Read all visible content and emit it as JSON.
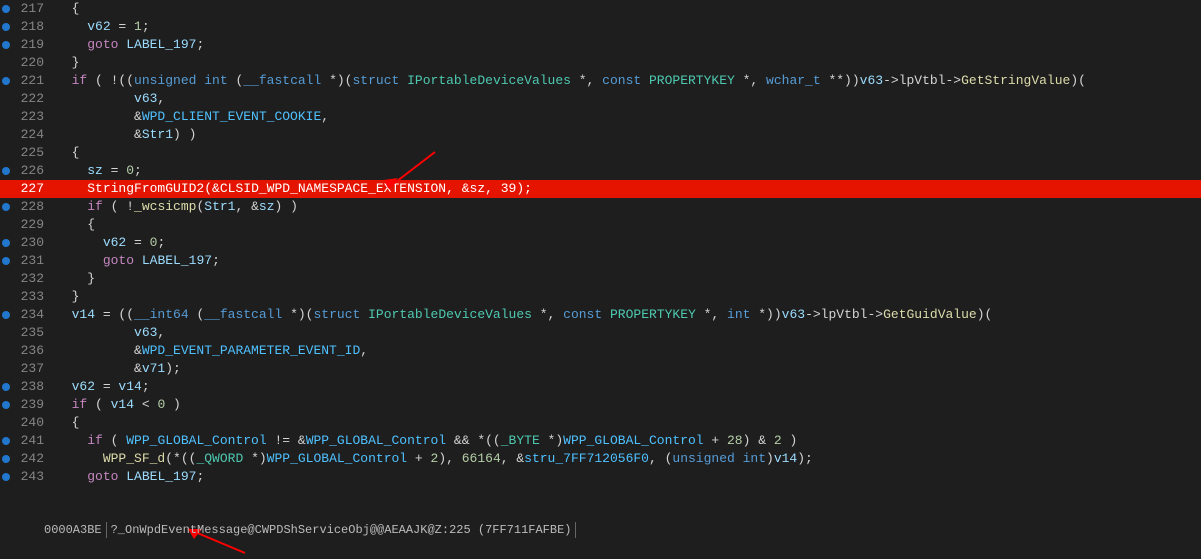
{
  "statusbar": {
    "offset": "0000A3BE",
    "location": "?_OnWpdEventMessage@CWPDShServiceObj@@AEAAJK@Z:225 (7FF711FAFBE)"
  },
  "lines": [
    {
      "num": "217",
      "bp": "blue",
      "tokens": [
        [
          "  {",
          ""
        ]
      ]
    },
    {
      "num": "218",
      "bp": "blue",
      "tokens": [
        [
          "    ",
          ""
        ],
        [
          "v62",
          "var"
        ],
        [
          " = ",
          ""
        ],
        [
          "1",
          "num"
        ],
        [
          ";",
          ""
        ]
      ]
    },
    {
      "num": "219",
      "bp": "blue",
      "tokens": [
        [
          "    ",
          ""
        ],
        [
          "goto",
          "kw"
        ],
        [
          " ",
          ""
        ],
        [
          "LABEL_197",
          "label"
        ],
        [
          ";",
          ""
        ]
      ]
    },
    {
      "num": "220",
      "bp": "",
      "tokens": [
        [
          "  }",
          ""
        ]
      ]
    },
    {
      "num": "221",
      "bp": "blue",
      "tokens": [
        [
          "  ",
          ""
        ],
        [
          "if",
          "kw"
        ],
        [
          " ( !((",
          ""
        ],
        [
          "unsigned int",
          "macro"
        ],
        [
          " (",
          ""
        ],
        [
          "__fastcall",
          "macro"
        ],
        [
          " *)(",
          ""
        ],
        [
          "struct",
          "macro"
        ],
        [
          " ",
          ""
        ],
        [
          "IPortableDeviceValues",
          "type"
        ],
        [
          " *, ",
          ""
        ],
        [
          "const",
          "macro"
        ],
        [
          " ",
          ""
        ],
        [
          "PROPERTYKEY",
          "type"
        ],
        [
          " *, ",
          ""
        ],
        [
          "wchar_t",
          "macro"
        ],
        [
          " **))",
          ""
        ],
        [
          "v63",
          "var"
        ],
        [
          "->",
          ""
        ],
        [
          "lpVtbl",
          "member"
        ],
        [
          "->",
          ""
        ],
        [
          "GetStringValue",
          "fn"
        ],
        [
          ")(",
          ""
        ]
      ]
    },
    {
      "num": "222",
      "bp": "",
      "tokens": [
        [
          "          ",
          ""
        ],
        [
          "v63",
          "var"
        ],
        [
          ",",
          ""
        ]
      ]
    },
    {
      "num": "223",
      "bp": "",
      "tokens": [
        [
          "          &",
          ""
        ],
        [
          "WPD_CLIENT_EVENT_COOKIE",
          "const"
        ],
        [
          ",",
          ""
        ]
      ]
    },
    {
      "num": "224",
      "bp": "",
      "tokens": [
        [
          "          &",
          ""
        ],
        [
          "Str1",
          "var"
        ],
        [
          ") )",
          ""
        ]
      ]
    },
    {
      "num": "225",
      "bp": "",
      "tokens": [
        [
          "  {",
          ""
        ]
      ]
    },
    {
      "num": "226",
      "bp": "blue",
      "tokens": [
        [
          "    ",
          ""
        ],
        [
          "sz",
          "var"
        ],
        [
          " = ",
          ""
        ],
        [
          "0",
          "num"
        ],
        [
          ";",
          ""
        ]
      ]
    },
    {
      "num": "227",
      "bp": "red",
      "hl": true,
      "tokens": [
        [
          "    ",
          ""
        ],
        [
          "StringFromGUID2",
          "fn"
        ],
        [
          "(&",
          ""
        ],
        [
          "CLSID_WPD_NAMESPACE_EXTENSION",
          "const"
        ],
        [
          ", &",
          ""
        ],
        [
          "sz",
          "var"
        ],
        [
          ", ",
          ""
        ],
        [
          "39",
          "num"
        ],
        [
          ");",
          ""
        ]
      ]
    },
    {
      "num": "228",
      "bp": "blue",
      "tokens": [
        [
          "    ",
          ""
        ],
        [
          "if",
          "kw"
        ],
        [
          " ( !",
          ""
        ],
        [
          "_wcsicmp",
          "fn"
        ],
        [
          "(",
          ""
        ],
        [
          "Str1",
          "var"
        ],
        [
          ", &",
          ""
        ],
        [
          "sz",
          "var"
        ],
        [
          ") )",
          ""
        ]
      ]
    },
    {
      "num": "229",
      "bp": "",
      "tokens": [
        [
          "    {",
          ""
        ]
      ]
    },
    {
      "num": "230",
      "bp": "blue",
      "tokens": [
        [
          "      ",
          ""
        ],
        [
          "v62",
          "var"
        ],
        [
          " = ",
          ""
        ],
        [
          "0",
          "num"
        ],
        [
          ";",
          ""
        ]
      ]
    },
    {
      "num": "231",
      "bp": "blue",
      "tokens": [
        [
          "      ",
          ""
        ],
        [
          "goto",
          "kw"
        ],
        [
          " ",
          ""
        ],
        [
          "LABEL_197",
          "label"
        ],
        [
          ";",
          ""
        ]
      ]
    },
    {
      "num": "232",
      "bp": "",
      "tokens": [
        [
          "    }",
          ""
        ]
      ]
    },
    {
      "num": "233",
      "bp": "",
      "tokens": [
        [
          "  }",
          ""
        ]
      ]
    },
    {
      "num": "234",
      "bp": "blue",
      "tokens": [
        [
          "  ",
          ""
        ],
        [
          "v14",
          "var"
        ],
        [
          " = ((",
          ""
        ],
        [
          "__int64",
          "macro"
        ],
        [
          " (",
          ""
        ],
        [
          "__fastcall",
          "macro"
        ],
        [
          " *)(",
          ""
        ],
        [
          "struct",
          "macro"
        ],
        [
          " ",
          ""
        ],
        [
          "IPortableDeviceValues",
          "type"
        ],
        [
          " *, ",
          ""
        ],
        [
          "const",
          "macro"
        ],
        [
          " ",
          ""
        ],
        [
          "PROPERTYKEY",
          "type"
        ],
        [
          " *, ",
          ""
        ],
        [
          "int",
          "macro"
        ],
        [
          " *))",
          ""
        ],
        [
          "v63",
          "var"
        ],
        [
          "->",
          ""
        ],
        [
          "lpVtbl",
          "member"
        ],
        [
          "->",
          ""
        ],
        [
          "GetGuidValue",
          "fn"
        ],
        [
          ")(",
          ""
        ]
      ]
    },
    {
      "num": "235",
      "bp": "",
      "tokens": [
        [
          "          ",
          ""
        ],
        [
          "v63",
          "var"
        ],
        [
          ",",
          ""
        ]
      ]
    },
    {
      "num": "236",
      "bp": "",
      "tokens": [
        [
          "          &",
          ""
        ],
        [
          "WPD_EVENT_PARAMETER_EVENT_ID",
          "const"
        ],
        [
          ",",
          ""
        ]
      ]
    },
    {
      "num": "237",
      "bp": "",
      "tokens": [
        [
          "          &",
          ""
        ],
        [
          "v71",
          "var"
        ],
        [
          ");",
          ""
        ]
      ]
    },
    {
      "num": "238",
      "bp": "blue",
      "tokens": [
        [
          "  ",
          ""
        ],
        [
          "v62",
          "var"
        ],
        [
          " = ",
          ""
        ],
        [
          "v14",
          "var"
        ],
        [
          ";",
          ""
        ]
      ]
    },
    {
      "num": "239",
      "bp": "blue",
      "tokens": [
        [
          "  ",
          ""
        ],
        [
          "if",
          "kw"
        ],
        [
          " ( ",
          ""
        ],
        [
          "v14",
          "var"
        ],
        [
          " < ",
          ""
        ],
        [
          "0",
          "num"
        ],
        [
          " )",
          ""
        ]
      ]
    },
    {
      "num": "240",
      "bp": "",
      "tokens": [
        [
          "  {",
          ""
        ]
      ]
    },
    {
      "num": "241",
      "bp": "blue",
      "tokens": [
        [
          "    ",
          ""
        ],
        [
          "if",
          "kw"
        ],
        [
          " ( ",
          ""
        ],
        [
          "WPP_GLOBAL_Control",
          "const"
        ],
        [
          " != &",
          ""
        ],
        [
          "WPP_GLOBAL_Control",
          "const"
        ],
        [
          " && *((",
          ""
        ],
        [
          "_BYTE",
          "type"
        ],
        [
          " *)",
          ""
        ],
        [
          "WPP_GLOBAL_Control",
          "const"
        ],
        [
          " + ",
          ""
        ],
        [
          "28",
          "num"
        ],
        [
          ") & ",
          ""
        ],
        [
          "2",
          "num"
        ],
        [
          " )",
          ""
        ]
      ]
    },
    {
      "num": "242",
      "bp": "blue",
      "tokens": [
        [
          "      ",
          ""
        ],
        [
          "WPP_SF_d",
          "fn"
        ],
        [
          "(*((",
          ""
        ],
        [
          "_QWORD",
          "type"
        ],
        [
          " *)",
          ""
        ],
        [
          "WPP_GLOBAL_Control",
          "const"
        ],
        [
          " + ",
          ""
        ],
        [
          "2",
          "num"
        ],
        [
          "), ",
          ""
        ],
        [
          "66164",
          "num"
        ],
        [
          ", &",
          ""
        ],
        [
          "stru_7FF712056F0",
          "const"
        ],
        [
          ", (",
          ""
        ],
        [
          "unsigned int",
          "macro"
        ],
        [
          ")",
          ""
        ],
        [
          "v14",
          "var"
        ],
        [
          ");",
          ""
        ]
      ]
    },
    {
      "num": "243",
      "bp": "blue",
      "tokens": [
        [
          "    ",
          ""
        ],
        [
          "goto",
          "kw"
        ],
        [
          " ",
          ""
        ],
        [
          "LABEL_197",
          "label"
        ],
        [
          ";",
          ""
        ]
      ]
    }
  ]
}
